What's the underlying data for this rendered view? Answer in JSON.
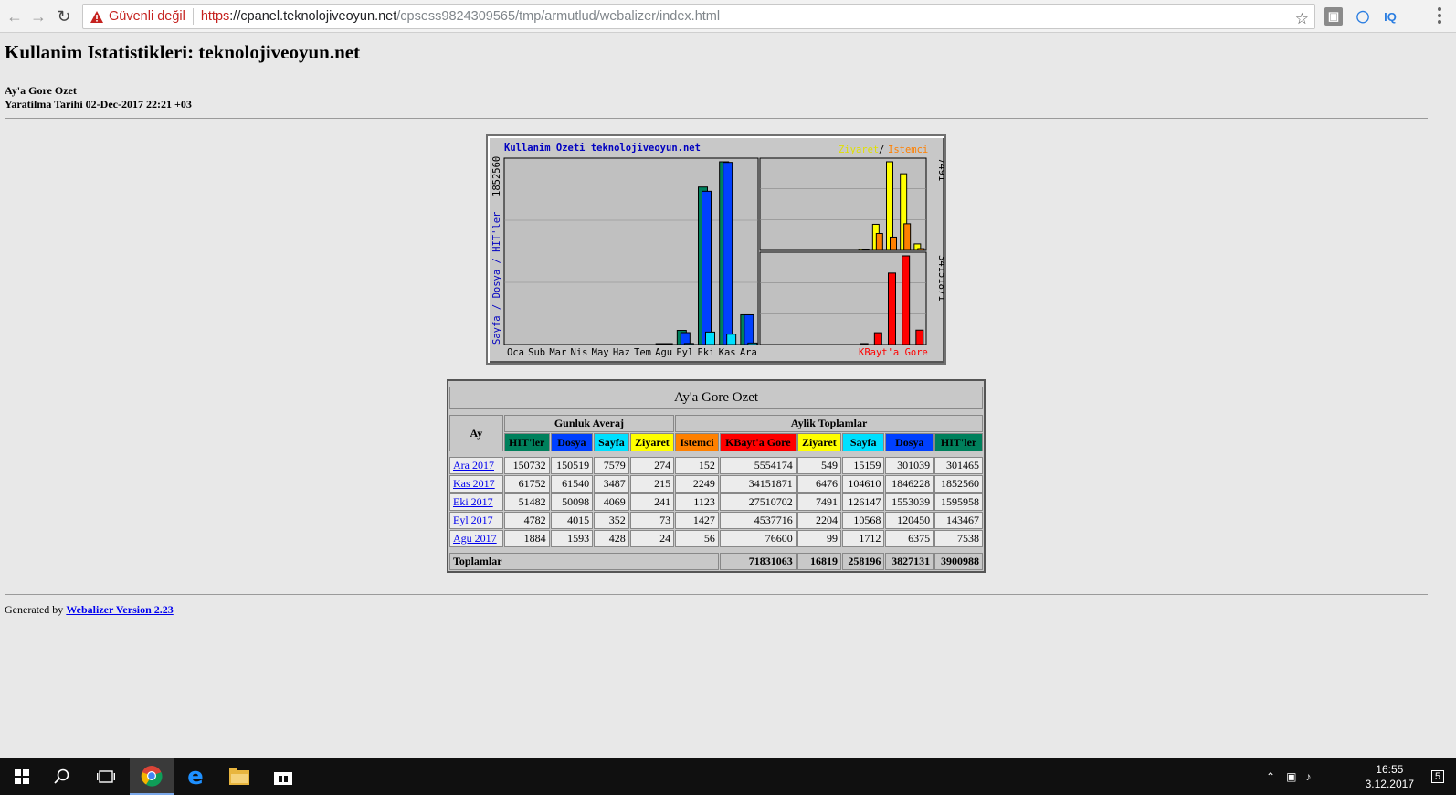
{
  "browser": {
    "security_label": "Güvenli değil",
    "url_scheme": "https",
    "url_host": "://cpanel.teknolojiveoyun.net",
    "url_path": "/cpsess9824309565/tmp/armutlud/webalizer/index.html",
    "ext_iq": "IQ"
  },
  "page": {
    "title": "Kullanim Istatistikleri: teknolojiveoyun.net",
    "subtitle": "Ay'a Gore Ozet",
    "generated": "Yaratilma Tarihi 02-Dec-2017 22:21 +03"
  },
  "chart_data": {
    "type": "bar",
    "title": "Kullanim Ozeti teknolojiveoyun.net",
    "categories": [
      "Oca",
      "Sub",
      "Mar",
      "Nis",
      "May",
      "Haz",
      "Tem",
      "Agu",
      "Eyl",
      "Eki",
      "Kas",
      "Ara"
    ],
    "left_axis_label": "Sayfa / Dosya / HIT'ler",
    "left_axis_max": "1852560",
    "top_right_legend": [
      "Ziyaret",
      "/",
      "Istemci"
    ],
    "top_right_max": "7491",
    "bottom_right_legend": "KBayt'a Gore",
    "bottom_right_max": "34151871",
    "colors": {
      "hits": "#00805c",
      "files": "#0040ff",
      "pages": "#00e0ff",
      "visits": "#ffff00",
      "sites": "#ff8000",
      "kbytes": "#ff0000"
    },
    "series": [
      {
        "name": "HIT'ler",
        "values": [
          0,
          0,
          0,
          0,
          0,
          0,
          0,
          7538,
          143467,
          1595958,
          1852560,
          301465
        ]
      },
      {
        "name": "Dosya",
        "values": [
          0,
          0,
          0,
          0,
          0,
          0,
          0,
          6375,
          120450,
          1553039,
          1846228,
          301039
        ]
      },
      {
        "name": "Sayfa",
        "values": [
          0,
          0,
          0,
          0,
          0,
          0,
          0,
          1712,
          10568,
          126147,
          104610,
          15159
        ]
      },
      {
        "name": "Ziyaret",
        "values": [
          0,
          0,
          0,
          0,
          0,
          0,
          0,
          99,
          2204,
          7491,
          6476,
          549
        ]
      },
      {
        "name": "Istemci",
        "values": [
          0,
          0,
          0,
          0,
          0,
          0,
          0,
          56,
          1427,
          1123,
          2249,
          152
        ]
      },
      {
        "name": "KBayt'a Gore",
        "values": [
          0,
          0,
          0,
          0,
          0,
          0,
          0,
          76600,
          4537716,
          27510702,
          34151871,
          5554174
        ]
      }
    ]
  },
  "table": {
    "title": "Ay'a Gore Ozet",
    "month_header": "Ay",
    "daily_header": "Gunluk Averaj",
    "monthly_header": "Aylik Toplamlar",
    "columns": [
      {
        "label": "HIT'ler",
        "bg": "#00805c",
        "fg": "#000000"
      },
      {
        "label": "Dosya",
        "bg": "#0040ff",
        "fg": "#000000"
      },
      {
        "label": "Sayfa",
        "bg": "#00e0ff",
        "fg": "#000000"
      },
      {
        "label": "Ziyaret",
        "bg": "#ffff00",
        "fg": "#000000"
      },
      {
        "label": "Istemci",
        "bg": "#ff8000",
        "fg": "#000000"
      },
      {
        "label": "KBayt'a Gore",
        "bg": "#ff0000",
        "fg": "#000000"
      },
      {
        "label": "Ziyaret",
        "bg": "#ffff00",
        "fg": "#000000"
      },
      {
        "label": "Sayfa",
        "bg": "#00e0ff",
        "fg": "#000000"
      },
      {
        "label": "Dosya",
        "bg": "#0040ff",
        "fg": "#000000"
      },
      {
        "label": "HIT'ler",
        "bg": "#00805c",
        "fg": "#000000"
      }
    ],
    "rows": [
      {
        "month": "Ara 2017",
        "values": [
          "150732",
          "150519",
          "7579",
          "274",
          "152",
          "5554174",
          "549",
          "15159",
          "301039",
          "301465"
        ]
      },
      {
        "month": "Kas 2017",
        "values": [
          "61752",
          "61540",
          "3487",
          "215",
          "2249",
          "34151871",
          "6476",
          "104610",
          "1846228",
          "1852560"
        ]
      },
      {
        "month": "Eki 2017",
        "values": [
          "51482",
          "50098",
          "4069",
          "241",
          "1123",
          "27510702",
          "7491",
          "126147",
          "1553039",
          "1595958"
        ]
      },
      {
        "month": "Eyl 2017",
        "values": [
          "4782",
          "4015",
          "352",
          "73",
          "1427",
          "4537716",
          "2204",
          "10568",
          "120450",
          "143467"
        ]
      },
      {
        "month": "Agu 2017",
        "values": [
          "1884",
          "1593",
          "428",
          "24",
          "56",
          "76600",
          "99",
          "1712",
          "6375",
          "7538"
        ]
      }
    ],
    "totals_label": "Toplamlar",
    "totals": [
      "71831063",
      "16819",
      "258196",
      "3827131",
      "3900988"
    ]
  },
  "footer": {
    "prefix": "Generated by",
    "link": "Webalizer Version 2.23"
  },
  "taskbar": {
    "time": "16:55",
    "date": "3.12.2017",
    "notification_count": "5"
  }
}
